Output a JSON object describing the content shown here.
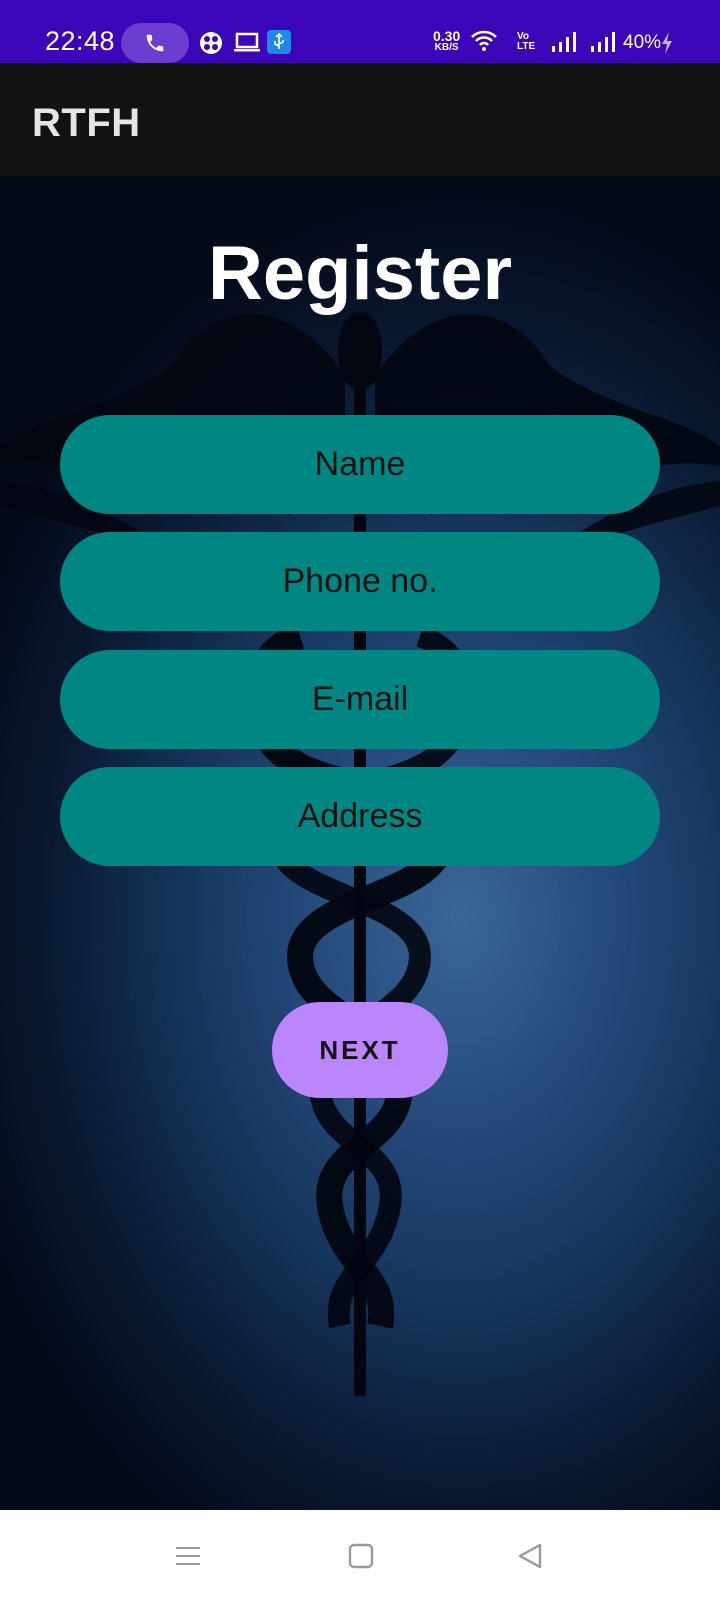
{
  "status_bar": {
    "time": "22:48",
    "net_speed": "0.30",
    "net_unit": "KB/S",
    "volte": "Vo\nLTE",
    "battery": "40%",
    "icons": [
      "phone-call-icon",
      "tracking-icon",
      "laptop-icon",
      "usb-icon",
      "wifi-icon",
      "signal-1-icon",
      "signal-2-icon",
      "charging-icon"
    ]
  },
  "app_bar": {
    "title": "RTFH"
  },
  "page": {
    "title": "Register"
  },
  "form": {
    "name_placeholder": "Name",
    "phone_placeholder": "Phone no.",
    "email_placeholder": "E-mail",
    "address_placeholder": "Address",
    "next_label": "NEXT"
  },
  "colors": {
    "status_bar": "#3a06b8",
    "app_bar": "#121212",
    "field": "#008784",
    "button": "#bb86fc"
  },
  "nav_bar": {
    "icons": [
      "menu-icon",
      "home-icon",
      "back-icon"
    ]
  }
}
